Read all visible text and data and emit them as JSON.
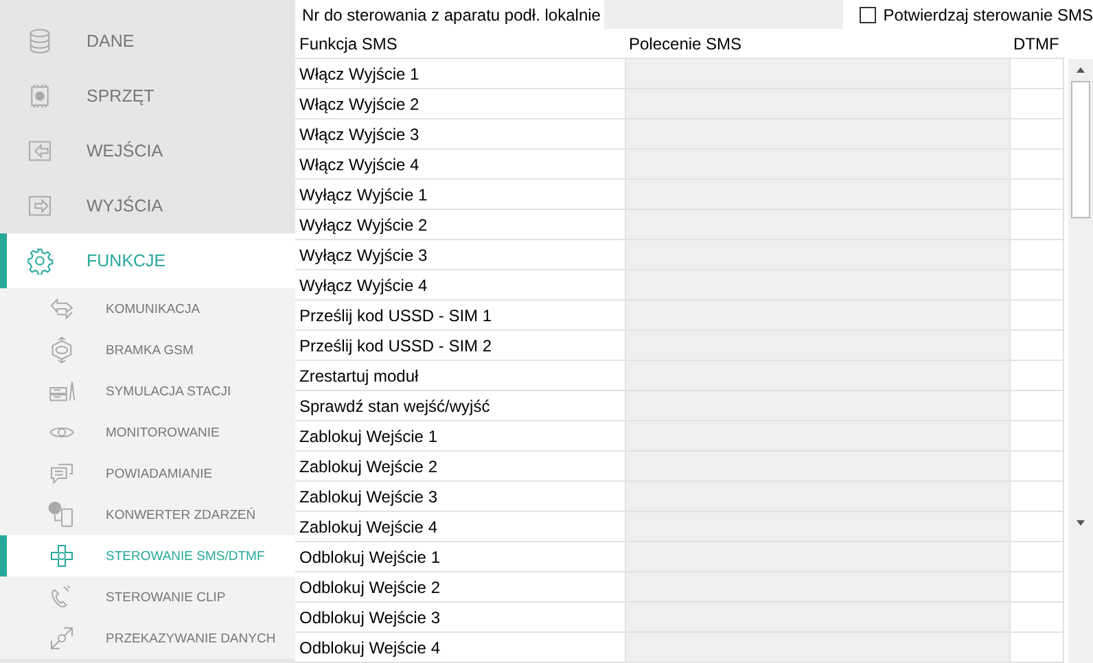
{
  "sidebar": {
    "items": [
      {
        "label": "DANE",
        "selected": false
      },
      {
        "label": "SPRZĘT",
        "selected": false
      },
      {
        "label": "WEJŚCIA",
        "selected": false
      },
      {
        "label": "WYJŚCIA",
        "selected": false
      },
      {
        "label": "FUNKCJE",
        "selected": true,
        "children": [
          {
            "label": "KOMUNIKACJA",
            "selected": false
          },
          {
            "label": "BRAMKA GSM",
            "selected": false
          },
          {
            "label": "SYMULACJA STACJI",
            "selected": false
          },
          {
            "label": "MONITOROWANIE",
            "selected": false
          },
          {
            "label": "POWIADAMIANIE",
            "selected": false
          },
          {
            "label": "KONWERTER ZDARZEŃ",
            "selected": false
          },
          {
            "label": "STEROWANIE SMS/DTMF",
            "selected": true
          },
          {
            "label": "STEROWANIE CLIP",
            "selected": false
          },
          {
            "label": "PRZEKAZYWANIE DANYCH",
            "selected": false
          }
        ]
      }
    ]
  },
  "local_number": {
    "label": "Nr do sterowania z aparatu podł. lokalnie"
  },
  "confirm_sms": {
    "label": "Potwierdzaj sterowanie SMS",
    "checked": false
  },
  "table": {
    "columns": [
      "Funkcja SMS",
      "Polecenie SMS",
      "DTMF"
    ],
    "rows": [
      "Włącz Wyjście 1",
      "Włącz Wyjście 2",
      "Włącz Wyjście 3",
      "Włącz Wyjście 4",
      "Wyłącz Wyjście 1",
      "Wyłącz Wyjście 2",
      "Wyłącz Wyjście 3",
      "Wyłącz Wyjście 4",
      "Prześlij kod USSD - SIM 1",
      "Prześlij kod USSD - SIM 2",
      "Zrestartuj moduł",
      "Sprawdź stan wejść/wyjść",
      "Zablokuj Wejście 1",
      "Zablokuj Wejście 2",
      "Zablokuj Wejście 3",
      "Zablokuj Wejście 4",
      "Odblokuj Wejście 1",
      "Odblokuj Wejście 2",
      "Odblokuj Wejście 3",
      "Odblokuj Wejście 4"
    ]
  }
}
